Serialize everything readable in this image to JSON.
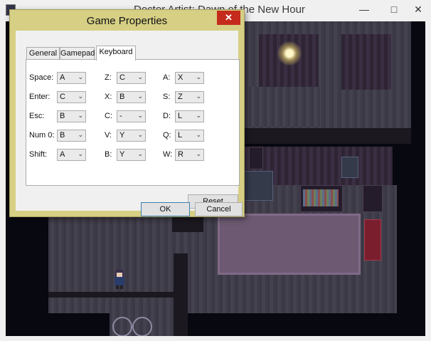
{
  "window": {
    "title": "Doctor Artist: Dawn of the New Hour",
    "minimize_icon": "minimize-icon",
    "maximize_icon": "maximize-icon",
    "close_icon": "close-icon"
  },
  "dialog": {
    "title": "Game Properties",
    "close_glyph": "✕",
    "tabs": [
      {
        "label": "General"
      },
      {
        "label": "Gamepad"
      },
      {
        "label": "Keyboard"
      }
    ],
    "active_tab": "Keyboard",
    "columns": [
      {
        "rows": [
          {
            "label": "Space:",
            "value": "A"
          },
          {
            "label": "Enter:",
            "value": "C"
          },
          {
            "label": "Esc:",
            "value": "B"
          },
          {
            "label": "Num 0:",
            "value": "B"
          },
          {
            "label": "Shift:",
            "value": "A"
          }
        ]
      },
      {
        "rows": [
          {
            "label": "Z:",
            "value": "C"
          },
          {
            "label": "X:",
            "value": "B"
          },
          {
            "label": "C:",
            "value": "-"
          },
          {
            "label": "V:",
            "value": "Y"
          },
          {
            "label": "B:",
            "value": "Y"
          }
        ]
      },
      {
        "rows": [
          {
            "label": "A:",
            "value": "X"
          },
          {
            "label": "S:",
            "value": "Z"
          },
          {
            "label": "D:",
            "value": "L"
          },
          {
            "label": "Q:",
            "value": "L"
          },
          {
            "label": "W:",
            "value": "R"
          }
        ]
      }
    ],
    "dropdown_arrow": "⌄",
    "reset_label": "Reset",
    "ok_label": "OK",
    "cancel_label": "Cancel"
  },
  "colors": {
    "dialog_frame": "#d6cf84",
    "close_button": "#c42b1c"
  }
}
